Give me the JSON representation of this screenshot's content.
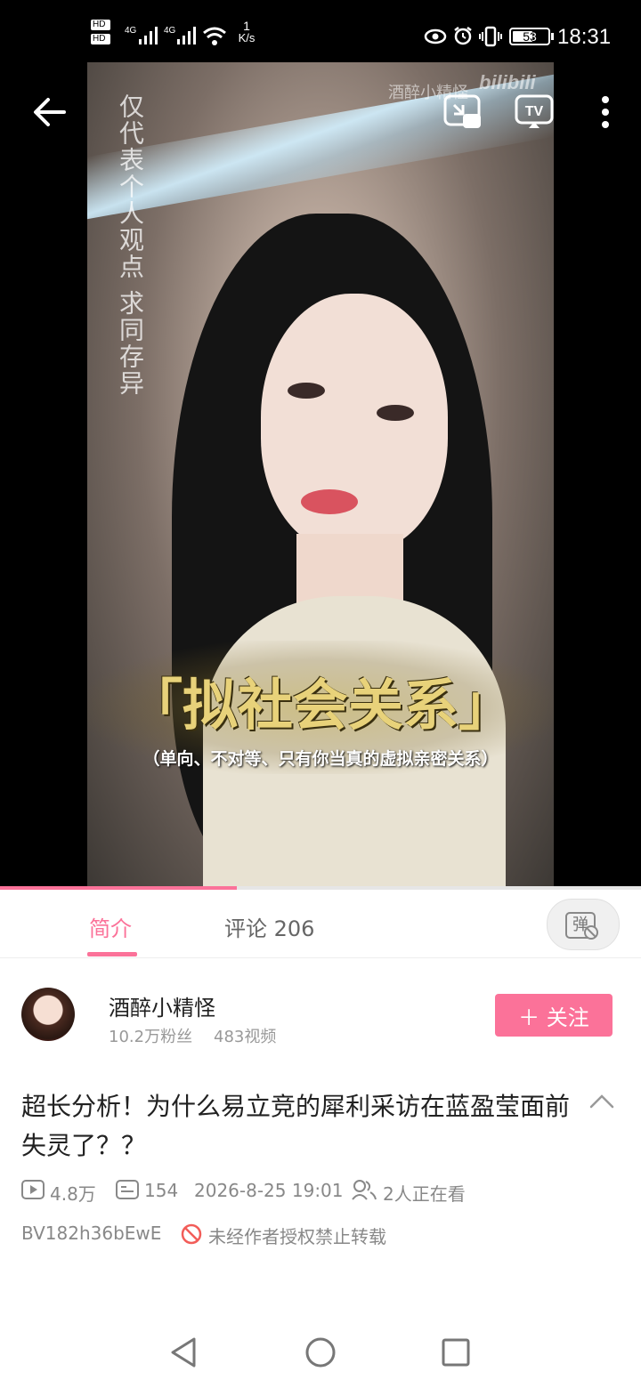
{
  "status": {
    "hd1": "HD",
    "hd2": "HD",
    "net1": "4G",
    "net2": "4G",
    "speed_value": "1",
    "speed_unit": "K/s",
    "battery": "53",
    "time": "18:31"
  },
  "video": {
    "watermark": "酒醉小精怪",
    "bili_logo": "bilibili",
    "side_text": "仅代表个人观点 求同存异",
    "caption_main": "「拟社会关系」",
    "caption_sub": "（单向、不对等、只有你当真的虚拟亲密关系）",
    "progress_fraction": 0.37
  },
  "tabs": [
    {
      "label": "简介"
    },
    {
      "label": "评论 206"
    }
  ],
  "danmaku_label": "弹",
  "uploader": {
    "name": "酒醉小精怪",
    "fans": "10.2万粉丝",
    "videos": "483视频",
    "follow_label": "＋ 关注"
  },
  "title": "超长分析！为什么易立竞的犀利采访在蓝盈莹面前失灵了？？",
  "stats": {
    "views": "4.8万",
    "danmaku": "154",
    "date": "2026-8-25 19:01",
    "watching": "2人正在看"
  },
  "bvid": "BV182h36bEwE",
  "copyright": "未经作者授权禁止转载",
  "colors": {
    "accent": "#fb7299",
    "text_primary": "#212121",
    "text_secondary": "#999999",
    "warning": "#f25d59"
  }
}
